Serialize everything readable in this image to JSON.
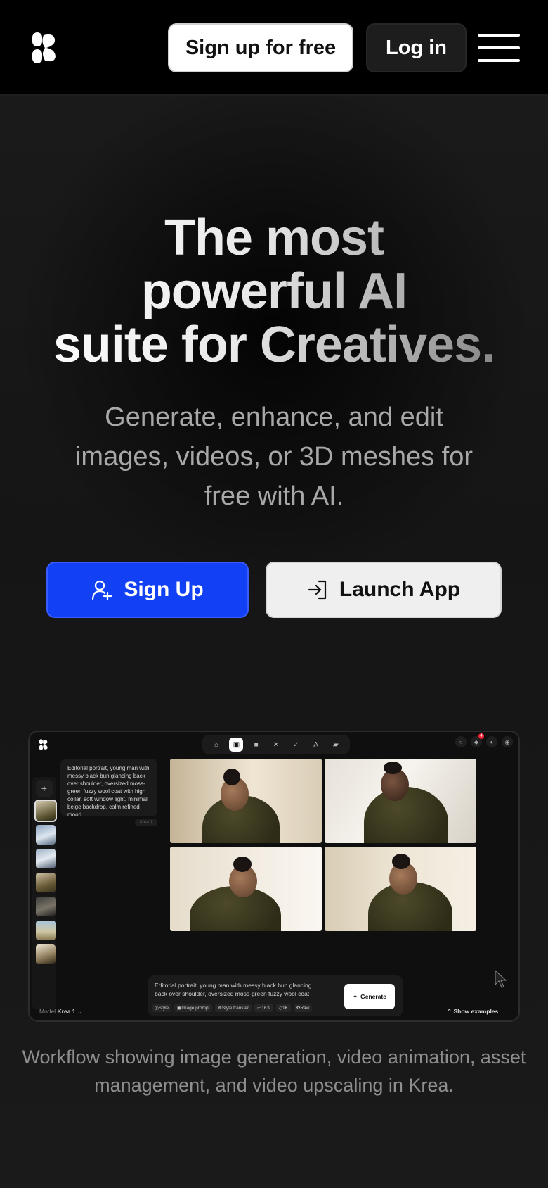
{
  "header": {
    "logo": "krea-logo",
    "signup_free_label": "Sign up for free",
    "login_label": "Log in",
    "menu_icon": "hamburger-menu-icon"
  },
  "hero": {
    "title_line1": "The most",
    "title_line2": "powerful AI",
    "title_line3": "suite for Creatives.",
    "subtitle": "Generate, enhance, and edit images, videos, or 3D meshes for free with AI.",
    "signup_label": "Sign Up",
    "launch_label": "Launch App"
  },
  "mockup": {
    "prompt_card_text": "Editorial portrait, young man with messy black bun glancing back over shoulder, oversized moss-green fuzzy wool coat with high collar, soft window light, minimal beige backdrop, calm refined mood",
    "model_chip": "Krea 1",
    "notification_count": "4",
    "bottom_prompt_text": "Editorial portrait, young man with messy black bun glancing back over shoulder, oversized moss-green fuzzy wool coat",
    "chips": [
      "Style",
      "Image prompt",
      "Style transfer",
      "16:9",
      "1K",
      "Raw"
    ],
    "generate_label": "Generate",
    "model_label": "Model",
    "model_value": "Krea 1",
    "show_examples_label": "Show examples"
  },
  "caption": "Workflow showing image generation, video animation, asset management, and video upscaling in Krea.",
  "colors": {
    "background": "#141414",
    "header": "#000000",
    "primary_blue": "#1140f5",
    "light_button": "#efefef"
  }
}
